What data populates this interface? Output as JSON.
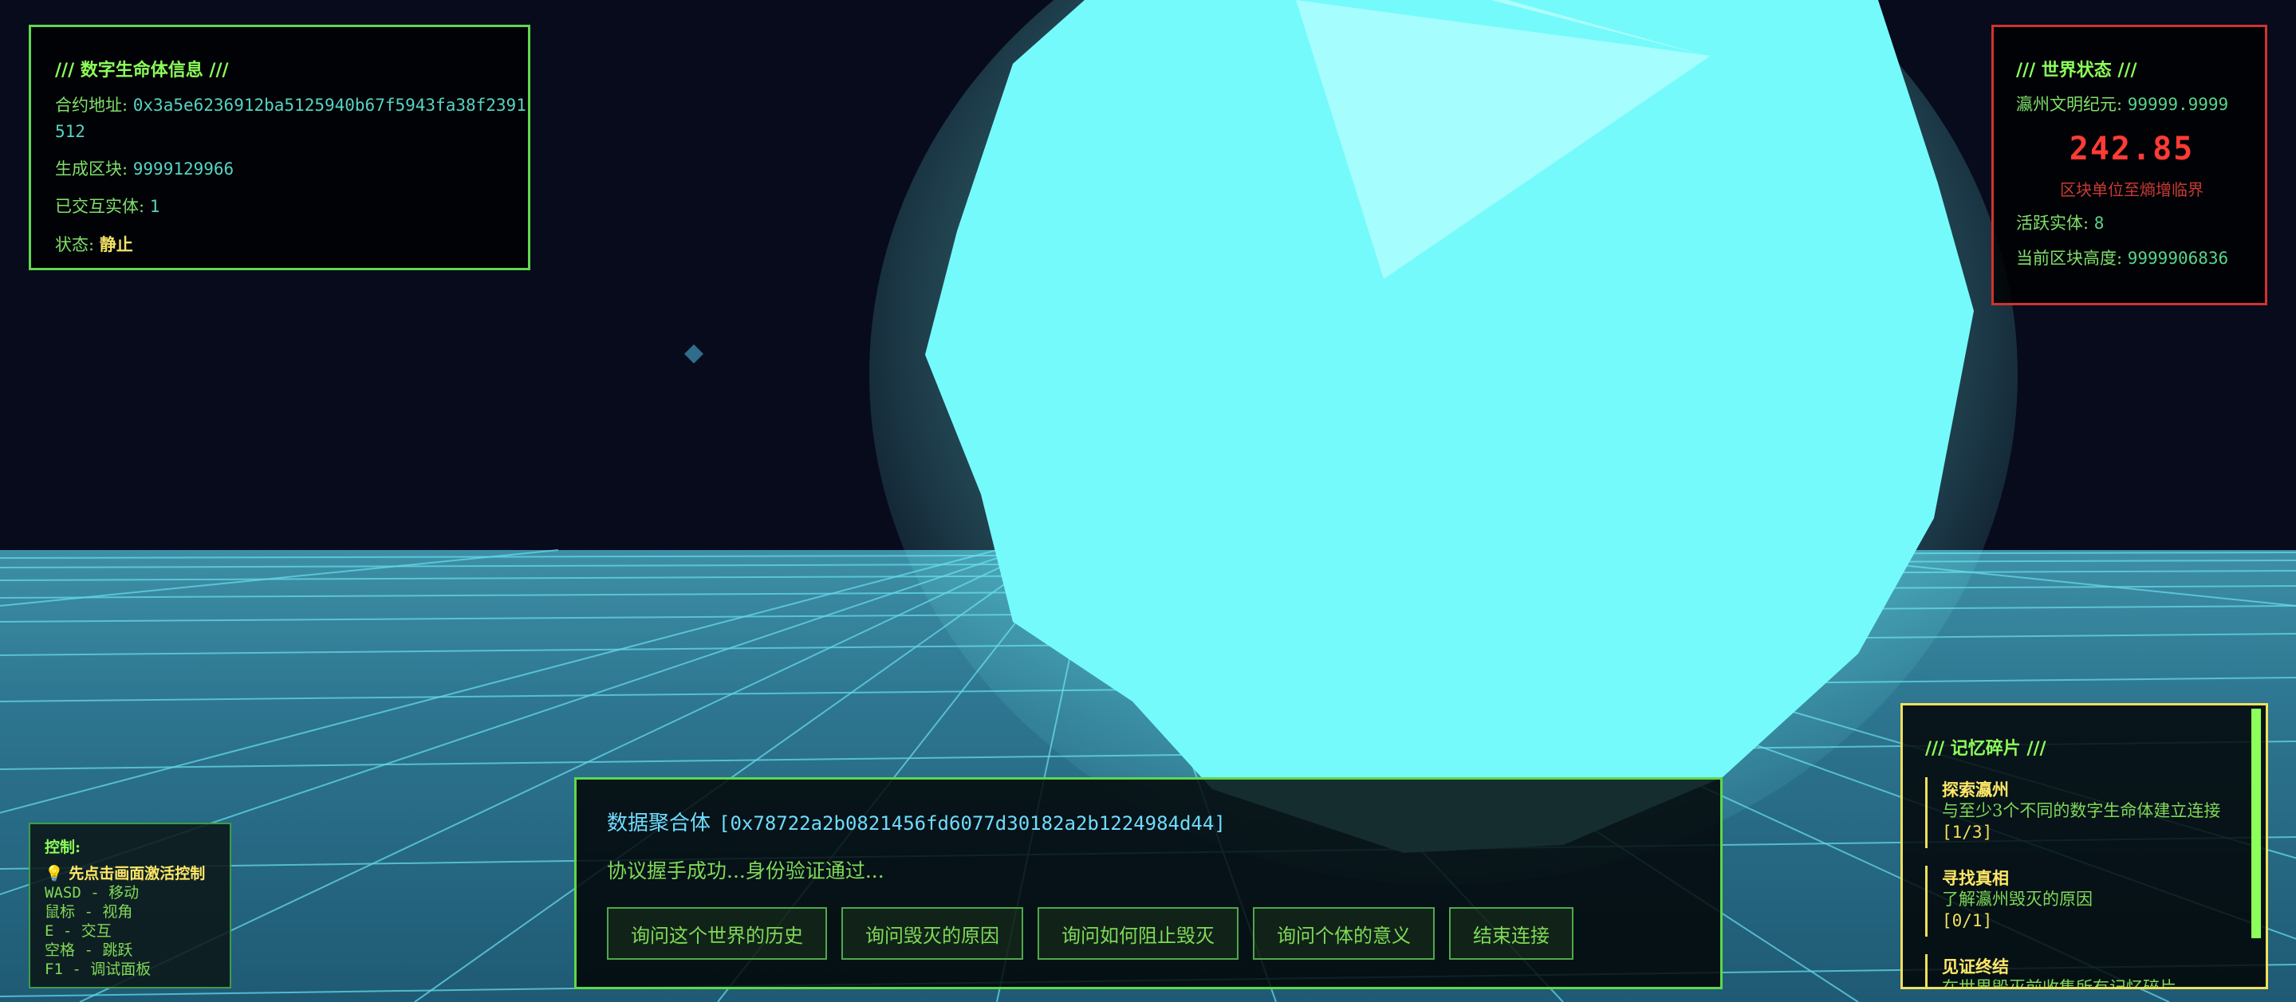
{
  "info": {
    "title": "/// 数字生命体信息 ///",
    "contract_label": "合约地址: ",
    "contract_value": "0x3a5e6236912ba5125940b67f5943fa38f2391512",
    "block_label": "生成区块: ",
    "block_value": "9999129966",
    "interacted_label": "已交互实体: ",
    "interacted_value": "1",
    "status_label": "状态: ",
    "status_value": "静止"
  },
  "world": {
    "title": "/// 世界状态 ///",
    "era_label": "瀛州文明纪元: ",
    "era_value": "99999.9999",
    "entropy_value": "242.85",
    "entropy_caption": "区块单位至熵增临界",
    "active_label": "活跃实体: ",
    "active_value": "8",
    "height_label": "当前区块高度: ",
    "height_value": "9999906836"
  },
  "controls": {
    "title": "控制:",
    "hint": "💡 先点击画面激活控制",
    "lines": [
      "WASD - 移动",
      "鼠标 - 视角",
      "E - 交互",
      "空格 - 跳跃",
      "F1 - 调试面板"
    ]
  },
  "dialog": {
    "speaker": "数据聚合体",
    "speaker_id": "[0x78722a2b0821456fd6077d30182a2b1224984d44]",
    "message": "协议握手成功...身份验证通过...",
    "options": [
      "询问这个世界的历史",
      "询问毁灭的原因",
      "询问如何阻止毁灭",
      "询问个体的意义",
      "结束连接"
    ]
  },
  "memory": {
    "title": "/// 记忆碎片 ///",
    "items": [
      {
        "title": "探索瀛州",
        "desc": "与至少3个不同的数字生命体建立连接",
        "progress": "[1/3]"
      },
      {
        "title": "寻找真相",
        "desc": "了解瀛州毁灭的原因",
        "progress": "[0/1]"
      },
      {
        "title": "见证终结",
        "desc": "在世界毁灭前收集所有记忆碎片",
        "progress": ""
      }
    ]
  },
  "colors": {
    "sky": "#070b1c",
    "ground": "#2b6b84",
    "grid": "#5fd6e6",
    "orb": "#75fafb",
    "accent_green": "#5fd84a",
    "accent_red": "#d1322d",
    "accent_yellow": "#f0e05a"
  }
}
